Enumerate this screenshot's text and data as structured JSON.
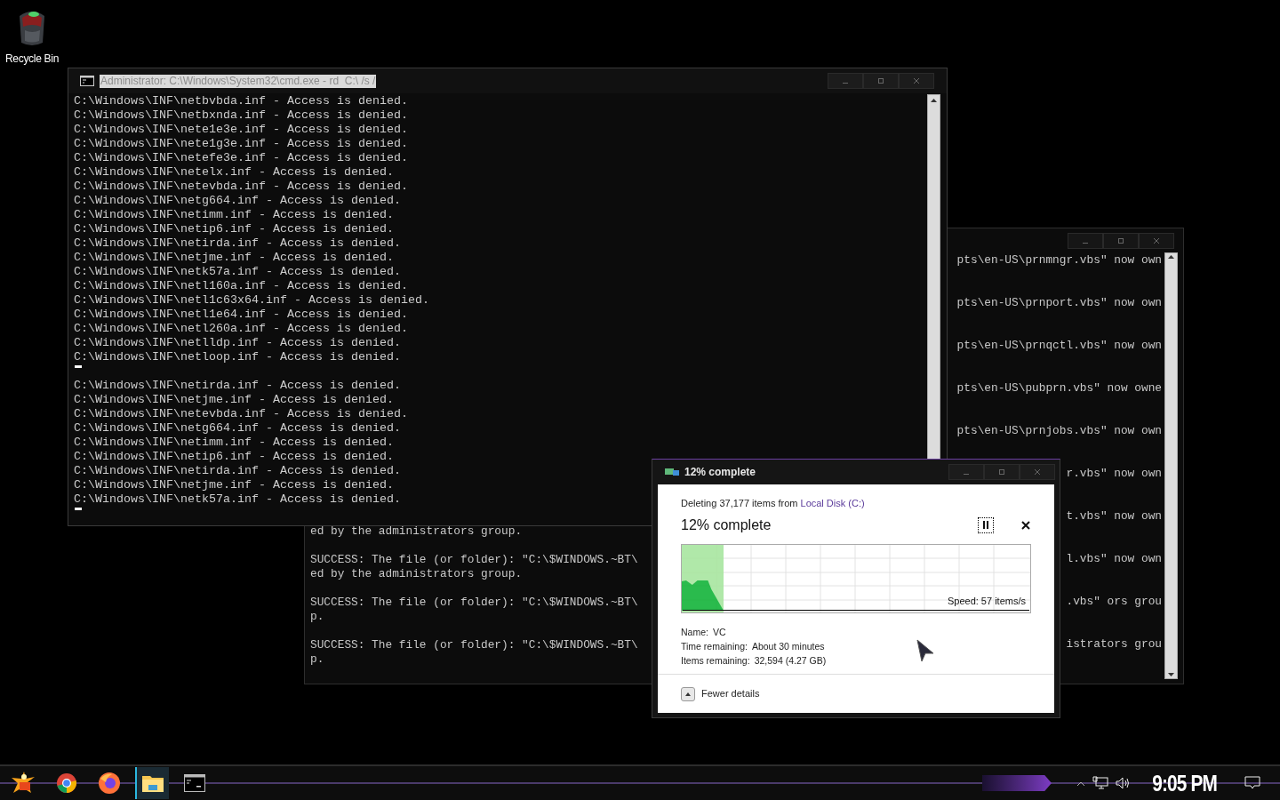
{
  "desktop_icons": [
    {
      "label": "Recycle Bin"
    }
  ],
  "back_console": {
    "left_blocks": [
      [
        "ed by the administrators group."
      ],
      [
        "SUCCESS: The file (or folder): \"C:\\$WINDOWS.~BT\\",
        "ed by the administrators group."
      ],
      [
        "SUCCESS: The file (or folder): \"C:\\$WINDOWS.~BT\\",
        "p."
      ],
      [
        "SUCCESS: The file (or folder): \"C:\\$WINDOWS.~BT\\",
        "p."
      ]
    ],
    "right_lines": [
      "pts\\en-US\\prnmngr.vbs\" now own",
      "pts\\en-US\\prnport.vbs\" now own",
      "pts\\en-US\\prnqctl.vbs\" now own",
      "pts\\en-US\\pubprn.vbs\" now owne",
      "pts\\en-US\\prnjobs.vbs\" now own",
      "r.vbs\" now own",
      "t.vbs\" now own",
      "l.vbs\" now own",
      ".vbs\" ors grou",
      "istrators grou"
    ]
  },
  "console": {
    "title": "Administrator: C:\\Windows\\System32\\cmd.exe - rd  C:\\ /s /",
    "lines": [
      {
        "kind": "text",
        "text": "C:\\Windows\\INF\\netbvbda.inf - Access is denied."
      },
      {
        "kind": "text",
        "text": "C:\\Windows\\INF\\netbxnda.inf - Access is denied."
      },
      {
        "kind": "text",
        "text": "C:\\Windows\\INF\\nete1e3e.inf - Access is denied."
      },
      {
        "kind": "text",
        "text": "C:\\Windows\\INF\\nete1g3e.inf - Access is denied."
      },
      {
        "kind": "text",
        "text": "C:\\Windows\\INF\\netefe3e.inf - Access is denied."
      },
      {
        "kind": "text",
        "text": "C:\\Windows\\INF\\netelx.inf - Access is denied."
      },
      {
        "kind": "text",
        "text": "C:\\Windows\\INF\\netevbda.inf - Access is denied."
      },
      {
        "kind": "text",
        "text": "C:\\Windows\\INF\\netg664.inf - Access is denied."
      },
      {
        "kind": "text",
        "text": "C:\\Windows\\INF\\netimm.inf - Access is denied."
      },
      {
        "kind": "text",
        "text": "C:\\Windows\\INF\\netip6.inf - Access is denied."
      },
      {
        "kind": "text",
        "text": "C:\\Windows\\INF\\netirda.inf - Access is denied."
      },
      {
        "kind": "text",
        "text": "C:\\Windows\\INF\\netjme.inf - Access is denied."
      },
      {
        "kind": "text",
        "text": "C:\\Windows\\INF\\netk57a.inf - Access is denied."
      },
      {
        "kind": "text",
        "text": "C:\\Windows\\INF\\netl160a.inf - Access is denied."
      },
      {
        "kind": "text",
        "text": "C:\\Windows\\INF\\netl1c63x64.inf - Access is denied."
      },
      {
        "kind": "text",
        "text": "C:\\Windows\\INF\\netl1e64.inf - Access is denied."
      },
      {
        "kind": "text",
        "text": "C:\\Windows\\INF\\netl260a.inf - Access is denied."
      },
      {
        "kind": "text",
        "text": "C:\\Windows\\INF\\netlldp.inf - Access is denied."
      },
      {
        "kind": "text",
        "text": "C:\\Windows\\INF\\netloop.inf - Access is denied."
      },
      {
        "kind": "cursor"
      },
      {
        "kind": "text",
        "text": "C:\\Windows\\INF\\netirda.inf - Access is denied."
      },
      {
        "kind": "text",
        "text": "C:\\Windows\\INF\\netjme.inf - Access is denied."
      },
      {
        "kind": "text",
        "text": "C:\\Windows\\INF\\netevbda.inf - Access is denied."
      },
      {
        "kind": "text",
        "text": "C:\\Windows\\INF\\netg664.inf - Access is denied."
      },
      {
        "kind": "text",
        "text": "C:\\Windows\\INF\\netimm.inf - Access is denied."
      },
      {
        "kind": "text",
        "text": "C:\\Windows\\INF\\netip6.inf - Access is denied."
      },
      {
        "kind": "text",
        "text": "C:\\Windows\\INF\\netirda.inf - Access is denied."
      },
      {
        "kind": "text",
        "text": "C:\\Windows\\INF\\netjme.inf - Access is denied."
      },
      {
        "kind": "text",
        "text": "C:\\Windows\\INF\\netk57a.inf - Access is denied."
      },
      {
        "kind": "cursor"
      }
    ]
  },
  "dialog": {
    "title": "12% complete",
    "summary": "Deleting 37,177 items from ",
    "source_link": "Local Disk (C:)",
    "heading": "12% complete",
    "progress": {
      "level": 0.12
    },
    "speed": "Speed: 57 items/s",
    "details": [
      {
        "label": "Name:",
        "value": "VC"
      },
      {
        "label": "Time remaining:",
        "value": "About 30 minutes"
      },
      {
        "label": "Items remaining:",
        "value": "32,594 (4.27 GB)"
      }
    ],
    "toggle": "Fewer details"
  },
  "taskbar": {
    "apps": [
      {
        "kind": "start",
        "selected": false
      },
      {
        "kind": "chrome",
        "selected": false
      },
      {
        "kind": "firefox",
        "selected": false
      },
      {
        "kind": "explorer",
        "selected": true
      },
      {
        "kind": "terminal",
        "selected": false
      }
    ],
    "clock": "9:05 PM"
  }
}
